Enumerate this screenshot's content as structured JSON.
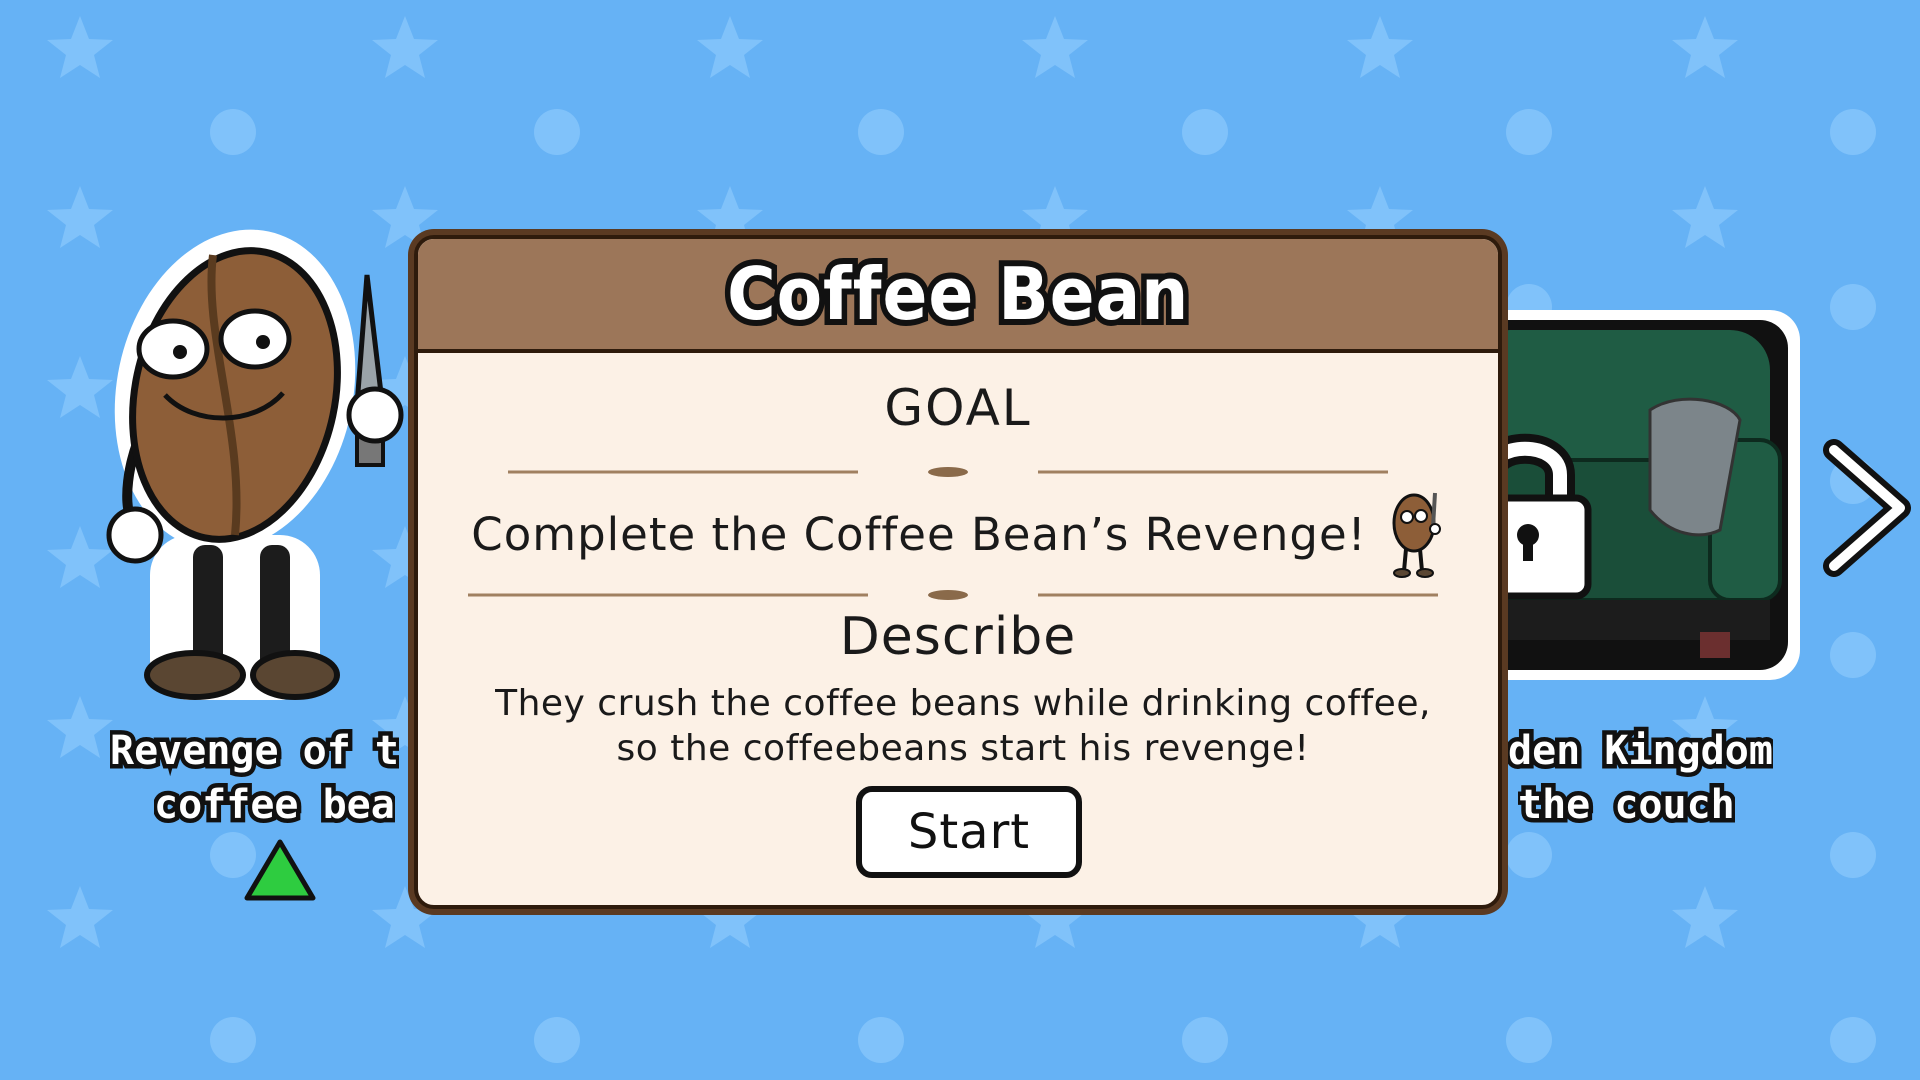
{
  "dialog": {
    "title": "Coffee Bean",
    "goal_heading": "GOAL",
    "goal_text": "Complete the Coffee Bean’s Revenge!",
    "describe_heading": "Describe",
    "describe_lines": [
      "They crush the coffee beans while drinking coffee,",
      "so the coffeebeans start his revenge!"
    ],
    "start_label": "Start"
  },
  "levels": {
    "left": {
      "title_lines": [
        "Revenge of t",
        "coffee bea"
      ],
      "icon": "coffee-bean-character-with-knife"
    },
    "right": {
      "title_lines": [
        "den Kingdom",
        "the couch"
      ],
      "icon": "locked-couch",
      "locked": true
    }
  },
  "icons": {
    "next": "chevron-right-icon",
    "selected": "green-triangle-icon"
  },
  "colors": {
    "background": "#66b2f5",
    "pattern": "#80c2fa",
    "dialog_header": "#9c7659",
    "dialog_body": "#fcf1e6",
    "dialog_border": "#5a3a22",
    "indicator": "#2ecc40"
  }
}
